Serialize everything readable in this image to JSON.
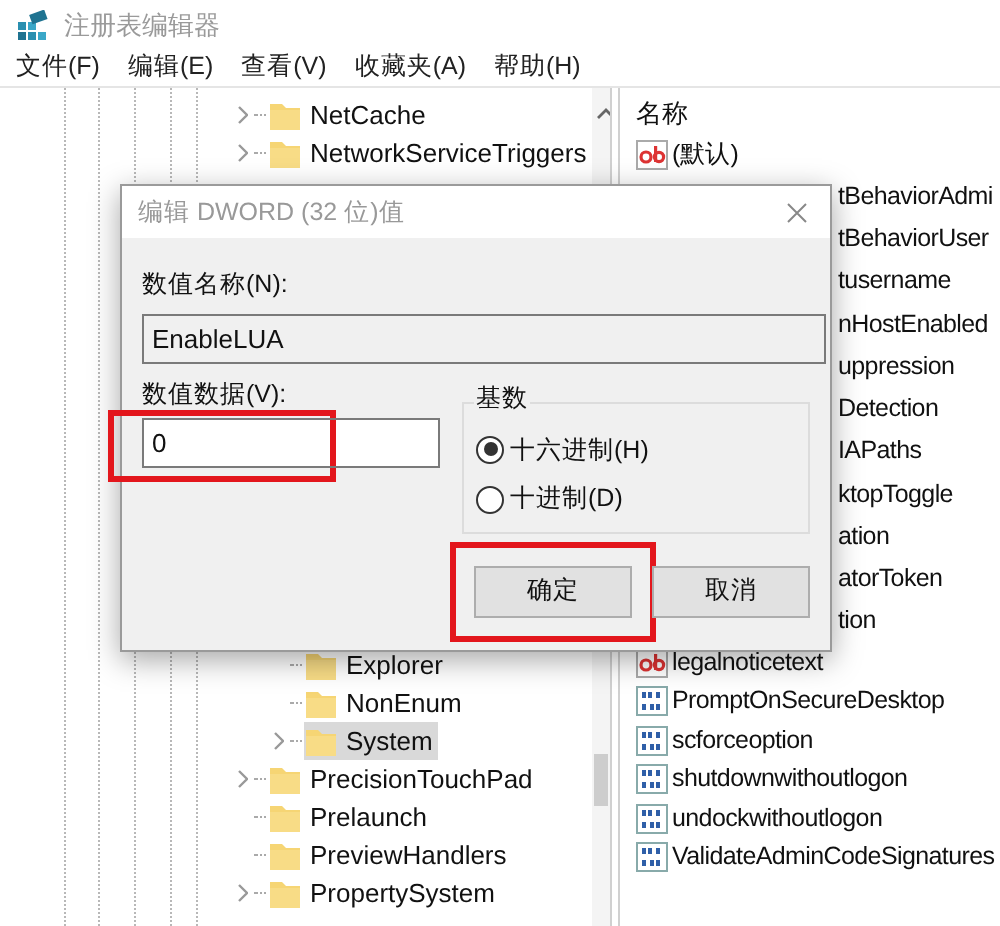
{
  "window": {
    "title": "注册表编辑器"
  },
  "menu": [
    "文件(F)",
    "编辑(E)",
    "查看(V)",
    "收藏夹(A)",
    "帮助(H)"
  ],
  "tree": [
    {
      "label": "NetCache",
      "expandable": true,
      "selected": false
    },
    {
      "label": "NetworkServiceTriggers",
      "expandable": true,
      "selected": false
    },
    {
      "children": [
        {
          "label": "Explorer",
          "expandable": false,
          "selected": false
        },
        {
          "label": "NonEnum",
          "expandable": false,
          "selected": false
        },
        {
          "label": "System",
          "expandable": true,
          "selected": true
        }
      ]
    },
    {
      "label": "PrecisionTouchPad",
      "expandable": true,
      "selected": false
    },
    {
      "label": "Prelaunch",
      "expandable": false,
      "selected": false
    },
    {
      "label": "PreviewHandlers",
      "expandable": false,
      "selected": false
    },
    {
      "label": "PropertySystem",
      "expandable": true,
      "selected": false
    }
  ],
  "values": {
    "column": "名称",
    "rows": [
      {
        "name": "(默认)",
        "kind": "string",
        "partial": false
      },
      {
        "name": "tBehaviorAdmi",
        "partial": true
      },
      {
        "name": "tBehaviorUser",
        "partial": true
      },
      {
        "name": "tusername",
        "partial": true
      },
      {
        "name": "nHostEnabled",
        "partial": true
      },
      {
        "name": "uppression",
        "partial": true
      },
      {
        "name": "Detection",
        "partial": true
      },
      {
        "name": "IAPaths",
        "partial": true
      },
      {
        "name": "ktopToggle",
        "partial": true
      },
      {
        "name": "ation",
        "partial": true
      },
      {
        "name": "atorToken",
        "partial": true
      },
      {
        "name": "tion",
        "partial": true
      },
      {
        "name": "legalnoticetext",
        "kind": "string",
        "partial": false
      },
      {
        "name": "PromptOnSecureDesktop",
        "kind": "dword",
        "partial": false
      },
      {
        "name": "scforceoption",
        "kind": "dword",
        "partial": false
      },
      {
        "name": "shutdownwithoutlogon",
        "kind": "dword",
        "partial": false
      },
      {
        "name": "undockwithoutlogon",
        "kind": "dword",
        "partial": false
      },
      {
        "name": "ValidateAdminCodeSignatures",
        "kind": "dword",
        "partial": false
      }
    ]
  },
  "dialog": {
    "title": "编辑 DWORD (32 位)值",
    "name_label": "数值名称(N):",
    "name_value": "EnableLUA",
    "data_label": "数值数据(V):",
    "data_value": "0",
    "base_label": "基数",
    "bases": [
      {
        "label": "十六进制(H)",
        "selected": true
      },
      {
        "label": "十进制(D)",
        "selected": false
      }
    ],
    "buttons": [
      {
        "label": "确定",
        "highlighted": true
      },
      {
        "label": "取消",
        "highlighted": false
      }
    ],
    "value_highlighted": true
  }
}
